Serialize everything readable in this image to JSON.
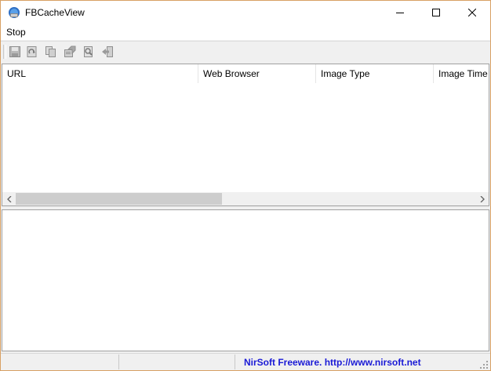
{
  "window": {
    "title": "FBCacheView",
    "icons": {
      "app": "fbcacheview-app-icon",
      "minimize": "minimize-icon",
      "maximize": "maximize-icon",
      "close": "close-icon"
    }
  },
  "menu": {
    "items": [
      {
        "label": "Stop"
      }
    ]
  },
  "toolbar": {
    "buttons": [
      {
        "icon": "save-icon",
        "enabled": false
      },
      {
        "icon": "refresh-icon",
        "enabled": false
      },
      {
        "icon": "copy-icon",
        "enabled": false
      },
      {
        "icon": "properties-icon",
        "enabled": false
      },
      {
        "icon": "find-icon",
        "enabled": false
      },
      {
        "icon": "exit-icon",
        "enabled": false
      }
    ]
  },
  "list": {
    "columns": [
      "URL",
      "Web Browser",
      "Image Type",
      "Image Time"
    ],
    "rows": []
  },
  "statusbar": {
    "link_text": "NirSoft Freeware.  http://www.nirsoft.net",
    "link_color": "#1a1ad6"
  }
}
